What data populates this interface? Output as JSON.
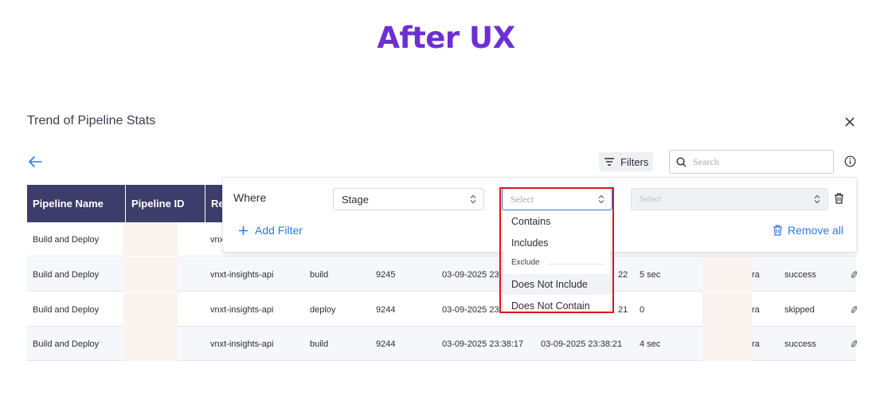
{
  "banner": {
    "title": "After UX"
  },
  "panel": {
    "title": "Trend of Pipeline Stats"
  },
  "toolbar": {
    "filters_label": "Filters",
    "search_placeholder": "Search"
  },
  "table": {
    "columns": [
      "Pipeline Name",
      "Pipeline ID",
      "Re"
    ],
    "rows": [
      {
        "name": "Build and Deploy",
        "repo": "vnx",
        "stage": "",
        "run": "",
        "start": "",
        "end": "",
        "duration": "",
        "user": "",
        "status": ""
      },
      {
        "name": "Build and Deploy",
        "repo": "vnxt-insights-api",
        "stage": "build",
        "run": "9245",
        "start": "03-09-2025 23",
        "end": "22",
        "duration": "5 sec",
        "user": "ra",
        "status": "success"
      },
      {
        "name": "Build and Deploy",
        "repo": "vnxt-insights-api",
        "stage": "deploy",
        "run": "9244",
        "start": "03-09-2025 23",
        "end": "21",
        "duration": "0",
        "user": "ra",
        "status": "skipped"
      },
      {
        "name": "Build and Deploy",
        "repo": "vnxt-insights-api",
        "stage": "build",
        "run": "9244",
        "start": "03-09-2025 23:38:17",
        "end": "03-09-2025 23:38:21",
        "duration": "4 sec",
        "user": "ra",
        "status": "success"
      }
    ]
  },
  "filter": {
    "where_label": "Where",
    "field_value": "Stage",
    "operator_placeholder": "Select",
    "value_placeholder": "Select",
    "add_filter_label": "Add Filter",
    "remove_all_label": "Remove all"
  },
  "operator_menu": {
    "items": [
      "Contains",
      "Includes",
      "Does Not Include",
      "Does Not Contain"
    ],
    "group_label": "Exclude",
    "hovered": "Does Not Include"
  },
  "colors": {
    "accent": "#2e7be6",
    "header_bg": "#3d3d6b",
    "banner": "#6b2fd4",
    "highlight": "#e0141e"
  }
}
